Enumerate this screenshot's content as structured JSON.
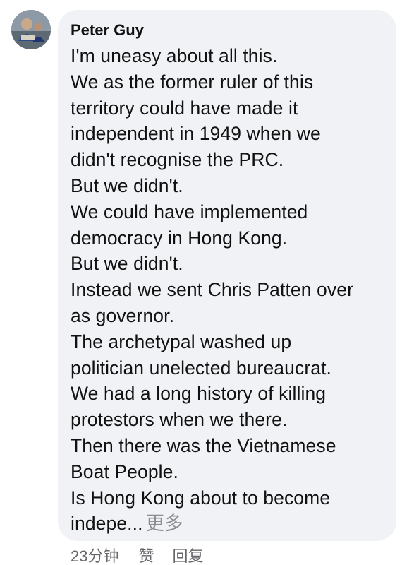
{
  "comment": {
    "author": "Peter Guy",
    "lines": [
      "I'm uneasy about all this.",
      "We as the former ruler of this",
      "territory could have made it",
      "independent in 1949 when we",
      "didn't recognise the PRC.",
      "But we didn't.",
      "We could have implemented",
      "democracy in Hong Kong.",
      "But we didn't.",
      "Instead we sent Chris Patten over",
      "as governor.",
      "The archetypal washed up",
      "politician unelected bureaucrat.",
      "We had a long history of killing",
      "protestors when we there.",
      "Then there was the Vietnamese",
      "Boat People.",
      "Is Hong Kong about to become"
    ],
    "truncated_line": "indepe...",
    "more_label": "更多",
    "bubble_color": "#f0f2f5",
    "avatar_icon": "user-avatar-photo"
  },
  "actions": {
    "timestamp": "23分钟",
    "like_label": "赞",
    "reply_label": "回复"
  }
}
